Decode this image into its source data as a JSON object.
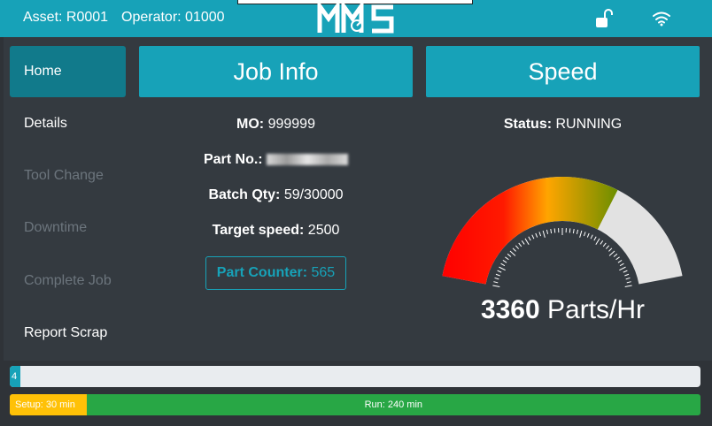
{
  "header": {
    "asset": "Asset: R0001",
    "operator": "Operator: 01000",
    "logo_text": "MMS"
  },
  "nav": [
    {
      "label": "Home",
      "state": "active"
    },
    {
      "label": "Details",
      "state": "enabled"
    },
    {
      "label": "Tool Change",
      "state": "disabled"
    },
    {
      "label": "Downtime",
      "state": "disabled"
    },
    {
      "label": "Complete Job",
      "state": "disabled"
    },
    {
      "label": "Report Scrap",
      "state": "enabled"
    }
  ],
  "job_info": {
    "title": "Job Info",
    "mo_label": "MO:",
    "mo_value": "999999",
    "part_label": "Part No.:",
    "batch_label": "Batch Qty:",
    "batch_value": "59/30000",
    "target_label": "Target speed:",
    "target_value": "2500",
    "counter_label": "Part Counter:",
    "counter_value": "565"
  },
  "speed": {
    "title": "Speed",
    "status_label": "Status:",
    "status_value": "RUNNING",
    "value": "3360",
    "unit": "Parts/Hr",
    "gauge_fraction": 0.67
  },
  "progress": {
    "value_label": "4",
    "percent": 1.5
  },
  "stages": {
    "setup": "Setup: 30 min",
    "run": "Run: 240 min",
    "setup_minutes": 30,
    "run_minutes": 240
  },
  "colors": {
    "accent": "#17a2b8",
    "warning": "#ffc107",
    "success": "#28a745"
  }
}
